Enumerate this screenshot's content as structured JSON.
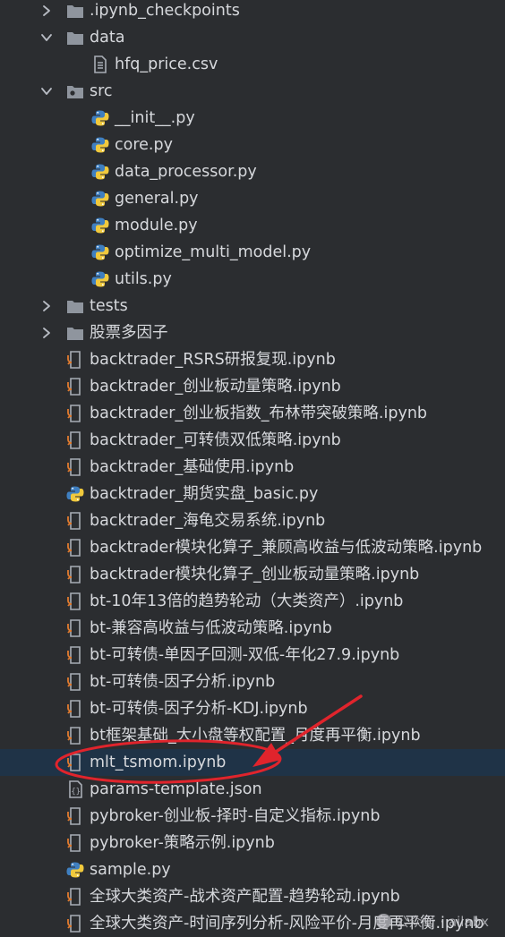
{
  "colors": {
    "background": "#2b2d30",
    "selection": "#1f3347",
    "text": "#d6d8dc",
    "folder": "#8f959e",
    "annotation": "#e0242c"
  },
  "tree": [
    {
      "label": ".ipynb_checkpoints",
      "type": "folder",
      "depth": 0,
      "chevron": "right"
    },
    {
      "label": "data",
      "type": "folder",
      "depth": 0,
      "chevron": "down"
    },
    {
      "label": "hfq_price.csv",
      "type": "text-file",
      "depth": 1
    },
    {
      "label": "src",
      "type": "package",
      "depth": 0,
      "chevron": "down"
    },
    {
      "label": "__init__.py",
      "type": "python",
      "depth": 1
    },
    {
      "label": "core.py",
      "type": "python",
      "depth": 1
    },
    {
      "label": "data_processor.py",
      "type": "python",
      "depth": 1
    },
    {
      "label": "general.py",
      "type": "python",
      "depth": 1
    },
    {
      "label": "module.py",
      "type": "python",
      "depth": 1
    },
    {
      "label": "optimize_multi_model.py",
      "type": "python",
      "depth": 1
    },
    {
      "label": "utils.py",
      "type": "python",
      "depth": 1
    },
    {
      "label": "tests",
      "type": "folder",
      "depth": 0,
      "chevron": "right"
    },
    {
      "label": "股票多因子",
      "type": "folder",
      "depth": 0,
      "chevron": "right"
    },
    {
      "label": "backtrader_RSRS研报复现.ipynb",
      "type": "notebook",
      "depth": 0
    },
    {
      "label": "backtrader_创业板动量策略.ipynb",
      "type": "notebook",
      "depth": 0
    },
    {
      "label": "backtrader_创业板指数_布林带突破策略.ipynb",
      "type": "notebook",
      "depth": 0
    },
    {
      "label": "backtrader_可转债双低策略.ipynb",
      "type": "notebook",
      "depth": 0
    },
    {
      "label": "backtrader_基础使用.ipynb",
      "type": "notebook",
      "depth": 0
    },
    {
      "label": "backtrader_期货实盘_basic.py",
      "type": "python",
      "depth": 0
    },
    {
      "label": "backtrader_海龟交易系统.ipynb",
      "type": "notebook",
      "depth": 0
    },
    {
      "label": "backtrader模块化算子_兼顾高收益与低波动策略.ipynb",
      "type": "notebook",
      "depth": 0
    },
    {
      "label": "backtrader模块化算子_创业板动量策略.ipynb",
      "type": "notebook",
      "depth": 0
    },
    {
      "label": "bt-10年13倍的趋势轮动（大类资产）.ipynb",
      "type": "notebook",
      "depth": 0
    },
    {
      "label": "bt-兼容高收益与低波动策略.ipynb",
      "type": "notebook",
      "depth": 0
    },
    {
      "label": "bt-可转债-单因子回测-双低-年化27.9.ipynb",
      "type": "notebook",
      "depth": 0
    },
    {
      "label": "bt-可转债-因子分析.ipynb",
      "type": "notebook",
      "depth": 0
    },
    {
      "label": "bt-可转债-因子分析-KDJ.ipynb",
      "type": "notebook",
      "depth": 0
    },
    {
      "label": "bt框架基础_大小盘等权配置_月度再平衡.ipynb",
      "type": "notebook",
      "depth": 0
    },
    {
      "label": "mlt_tsmom.ipynb",
      "type": "notebook",
      "depth": 0,
      "selected": true
    },
    {
      "label": "params-template.json",
      "type": "json",
      "depth": 0
    },
    {
      "label": "pybroker-创业板-择时-自定义指标.ipynb",
      "type": "notebook",
      "depth": 0
    },
    {
      "label": "pybroker-策略示例.ipynb",
      "type": "notebook",
      "depth": 0
    },
    {
      "label": "sample.py",
      "type": "python",
      "depth": 0
    },
    {
      "label": "全球大类资产-战术资产配置-趋势轮动.ipynb",
      "type": "notebook",
      "depth": 0
    },
    {
      "label": "全球大类资产-时间序列分析-风险平价-月度再平衡.ipynb",
      "type": "notebook",
      "depth": 0
    }
  ],
  "watermark": {
    "text": "公众号 · ailabx",
    "icon": "wechat-icon"
  }
}
